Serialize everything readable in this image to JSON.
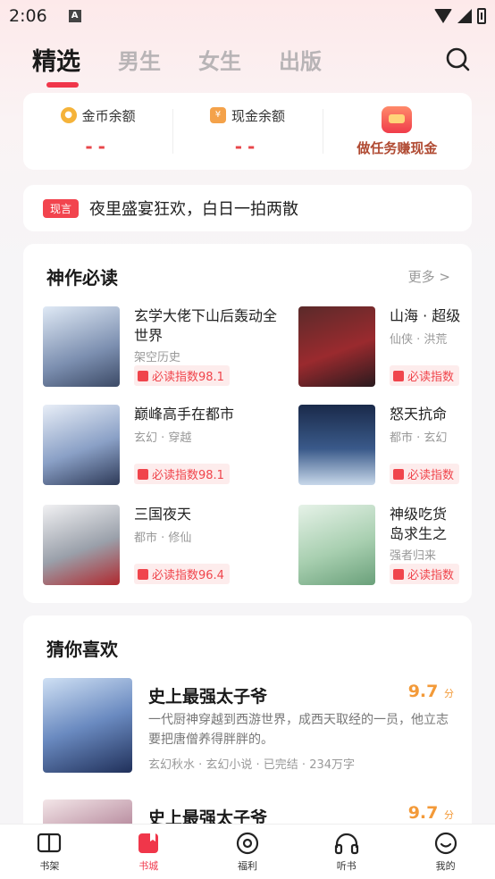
{
  "status": {
    "time": "2:06",
    "notif": "A"
  },
  "tabs": [
    {
      "label": "精选",
      "active": true
    },
    {
      "label": "男生"
    },
    {
      "label": "女生"
    },
    {
      "label": "出版"
    }
  ],
  "wallet": {
    "coin_label": "金币余额",
    "coin_value": "--",
    "cash_label": "现金余额",
    "cash_value": "--",
    "task_label": "做任务赚现金"
  },
  "notice": {
    "tag": "现言",
    "text": "夜里盛宴狂欢，白日一拍两散"
  },
  "must_read": {
    "title": "神作必读",
    "more": "更多 >",
    "items": [
      {
        "title": "玄学大佬下山后轰动全世界",
        "meta": "架空历史",
        "score": "必读指数98.1"
      },
      {
        "title": "山海 · 超级",
        "meta": "仙侠 · 洪荒",
        "score": "必读指数"
      },
      {
        "title": "巅峰高手在都市",
        "meta": "玄幻 · 穿越",
        "score": "必读指数98.1"
      },
      {
        "title": "怒天抗命",
        "meta": "都市 · 玄幻",
        "score": "必读指数"
      },
      {
        "title": "三国夜天",
        "meta": "都市 · 修仙",
        "score": "必读指数96.4"
      },
      {
        "title": "神级吃货岛求生之",
        "meta": "强者归来",
        "score": "必读指数"
      }
    ]
  },
  "guess": {
    "title": "猜你喜欢",
    "books": [
      {
        "title": "史上最强太子爷",
        "score": "9.7",
        "score_unit": "分",
        "desc": "一代厨神穿越到西游世界，成西天取经的一员，他立志要把唐僧养得胖胖的。",
        "meta": "玄幻秋水 · 玄幻小说 · 已完结 · 234万字"
      },
      {
        "title": "史上最强太子爷",
        "score": "9.7",
        "score_unit": "分",
        "desc": "",
        "meta": ""
      }
    ]
  },
  "tabbar": [
    {
      "label": "书架",
      "icon": "book-open-icon"
    },
    {
      "label": "书城",
      "icon": "bookstore-icon",
      "active": true
    },
    {
      "label": "福利",
      "icon": "eye-icon"
    },
    {
      "label": "听书",
      "icon": "headphones-icon"
    },
    {
      "label": "我的",
      "icon": "smile-icon"
    }
  ],
  "colors": {
    "accent": "#f0364a",
    "score": "#f39a39"
  }
}
